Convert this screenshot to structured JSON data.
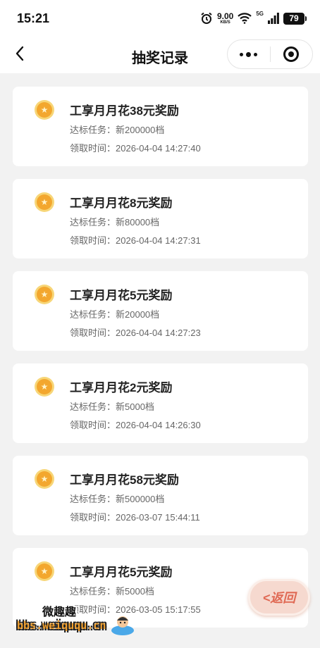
{
  "status_bar": {
    "time": "15:21",
    "net_speed_value": "9.00",
    "net_speed_unit": "KB/S",
    "network_type": "5G",
    "battery": "79",
    "icons": [
      "alarm-icon",
      "wifi-icon",
      "signal-icon",
      "battery-icon"
    ]
  },
  "nav": {
    "title": "抽奖记录",
    "back_icon": "chevron-left-icon",
    "more_icon": "more-dots-icon",
    "close_icon": "target-circle-icon"
  },
  "records": [
    {
      "title": "工享月月花38元奖励",
      "task": "达标任务：新200000档",
      "time": "领取时间：2026-04-04 14:27:40"
    },
    {
      "title": "工享月月花8元奖励",
      "task": "达标任务：新80000档",
      "time": "领取时间：2026-04-04 14:27:31"
    },
    {
      "title": "工享月月花5元奖励",
      "task": "达标任务：新20000档",
      "time": "领取时间：2026-04-04 14:27:23"
    },
    {
      "title": "工享月月花2元奖励",
      "task": "达标任务：新5000档",
      "time": "领取时间：2026-04-04 14:26:30"
    },
    {
      "title": "工享月月花58元奖励",
      "task": "达标任务：新500000档",
      "time": "领取时间：2026-03-07 15:44:11"
    },
    {
      "title": "工享月月花5元奖励",
      "task": "达标任务：新5000档",
      "time": "领取时间：2026-03-05 15:17:55"
    }
  ],
  "coin_icon": "star-coin-icon",
  "return_button": {
    "label": "<返回"
  },
  "watermark": {
    "line1": "微趣趣",
    "line2": "bbs.weiququ.cn"
  },
  "colors": {
    "coin_outer": "#f7d678",
    "coin_inner": "#f3a72e",
    "background": "#f2f2f2"
  }
}
